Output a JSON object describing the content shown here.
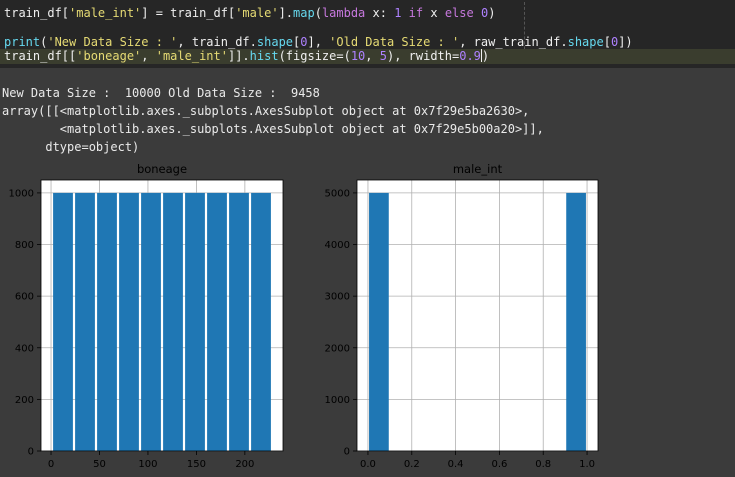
{
  "code": {
    "line1": [
      {
        "t": "train_df[",
        "c": "plain"
      },
      {
        "t": "'male_int'",
        "c": "str"
      },
      {
        "t": "] = train_df[",
        "c": "plain"
      },
      {
        "t": "'male'",
        "c": "str"
      },
      {
        "t": "].",
        "c": "plain"
      },
      {
        "t": "map",
        "c": "fn"
      },
      {
        "t": "(",
        "c": "plain"
      },
      {
        "t": "lambda",
        "c": "kw"
      },
      {
        "t": " x: ",
        "c": "plain"
      },
      {
        "t": "1",
        "c": "num"
      },
      {
        "t": " ",
        "c": "plain"
      },
      {
        "t": "if",
        "c": "kw"
      },
      {
        "t": " x ",
        "c": "plain"
      },
      {
        "t": "else",
        "c": "kw"
      },
      {
        "t": " ",
        "c": "plain"
      },
      {
        "t": "0",
        "c": "num"
      },
      {
        "t": ")",
        "c": "plain"
      }
    ],
    "line2": [],
    "line3": [
      {
        "t": "print",
        "c": "fn"
      },
      {
        "t": "(",
        "c": "plain"
      },
      {
        "t": "'New Data Size : '",
        "c": "str"
      },
      {
        "t": ", train_df.",
        "c": "plain"
      },
      {
        "t": "shape",
        "c": "fn"
      },
      {
        "t": "[",
        "c": "plain"
      },
      {
        "t": "0",
        "c": "num"
      },
      {
        "t": "], ",
        "c": "plain"
      },
      {
        "t": "'Old Data Size : '",
        "c": "str"
      },
      {
        "t": ", raw_train_df.",
        "c": "plain"
      },
      {
        "t": "shape",
        "c": "fn"
      },
      {
        "t": "[",
        "c": "plain"
      },
      {
        "t": "0",
        "c": "num"
      },
      {
        "t": "])",
        "c": "plain"
      }
    ],
    "line4": [
      {
        "t": "train_df[[",
        "c": "plain"
      },
      {
        "t": "'boneage'",
        "c": "str"
      },
      {
        "t": ", ",
        "c": "plain"
      },
      {
        "t": "'male_int'",
        "c": "str"
      },
      {
        "t": "]].",
        "c": "plain"
      },
      {
        "t": "hist",
        "c": "fn"
      },
      {
        "t": "(figsize=(",
        "c": "plain"
      },
      {
        "t": "10",
        "c": "num"
      },
      {
        "t": ", ",
        "c": "plain"
      },
      {
        "t": "5",
        "c": "num"
      },
      {
        "t": "), rwidth=",
        "c": "plain"
      },
      {
        "t": "0.9",
        "c": "num"
      },
      {
        "t": ")",
        "c": "plain"
      }
    ]
  },
  "output": {
    "line1": "New Data Size :  10000 Old Data Size :  9458",
    "line2": "array([[<matplotlib.axes._subplots.AxesSubplot object at 0x7f29e5ba2630>,",
    "line3": "        <matplotlib.axes._subplots.AxesSubplot object at 0x7f29e5b00a20>]],",
    "line4": "      dtype=object)"
  },
  "colors": {
    "bar": "#1f77b4",
    "grid": "#b0b0b0",
    "page": "#3b3b3b",
    "editor": "#262626"
  },
  "chart_data": [
    {
      "type": "bar",
      "title": "boneage",
      "bins": [
        {
          "x0": 1,
          "x1": 23.7,
          "y": 1000
        },
        {
          "x0": 23.7,
          "x1": 46.4,
          "y": 1000
        },
        {
          "x0": 46.4,
          "x1": 69.1,
          "y": 1000
        },
        {
          "x0": 69.1,
          "x1": 91.8,
          "y": 1000
        },
        {
          "x0": 91.8,
          "x1": 114.5,
          "y": 1000
        },
        {
          "x0": 114.5,
          "x1": 137.2,
          "y": 1000
        },
        {
          "x0": 137.2,
          "x1": 159.9,
          "y": 1000
        },
        {
          "x0": 159.9,
          "x1": 182.6,
          "y": 1000
        },
        {
          "x0": 182.6,
          "x1": 205.3,
          "y": 1000
        },
        {
          "x0": 205.3,
          "x1": 228,
          "y": 1000
        }
      ],
      "xlim": [
        -10.35,
        239.35
      ],
      "ylim": [
        0,
        1050
      ],
      "xticks": [
        0,
        50,
        100,
        150,
        200
      ],
      "yticks": [
        0,
        200,
        400,
        600,
        800,
        1000
      ],
      "grid": true
    },
    {
      "type": "bar",
      "title": "male_int",
      "bins": [
        {
          "x0": 0,
          "x1": 0.1,
          "y": 5000
        },
        {
          "x0": 0.1,
          "x1": 0.2,
          "y": 0
        },
        {
          "x0": 0.2,
          "x1": 0.3,
          "y": 0
        },
        {
          "x0": 0.3,
          "x1": 0.4,
          "y": 0
        },
        {
          "x0": 0.4,
          "x1": 0.5,
          "y": 0
        },
        {
          "x0": 0.5,
          "x1": 0.6,
          "y": 0
        },
        {
          "x0": 0.6,
          "x1": 0.7,
          "y": 0
        },
        {
          "x0": 0.7,
          "x1": 0.8,
          "y": 0
        },
        {
          "x0": 0.8,
          "x1": 0.9,
          "y": 0
        },
        {
          "x0": 0.9,
          "x1": 1.0,
          "y": 5000
        }
      ],
      "xlim": [
        -0.05,
        1.05
      ],
      "ylim": [
        0,
        5250
      ],
      "xticks": [
        "0.0",
        "0.2",
        "0.4",
        "0.6",
        "0.8",
        "1.0"
      ],
      "yticks": [
        0,
        1000,
        2000,
        3000,
        4000,
        5000
      ],
      "grid": true
    }
  ]
}
